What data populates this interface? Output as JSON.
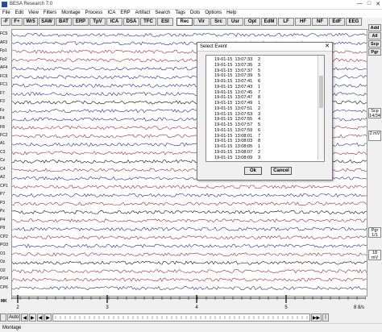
{
  "window": {
    "title": "BESA Research 7.0",
    "controls": [
      "—",
      "□",
      "✕"
    ]
  },
  "menu": [
    "File",
    "Edit",
    "View",
    "Filters",
    "Montage",
    "Process",
    "ICA",
    "ERP",
    "Artifact",
    "Search",
    "Tags",
    "Dots",
    "Options",
    "Help"
  ],
  "toolbar": [
    {
      "label": "-F",
      "w": 12
    },
    {
      "label": "F+",
      "w": 14
    },
    {
      "label": "Wr5",
      "w": 18
    },
    {
      "label": "SAW",
      "w": 20
    },
    {
      "label": "BAT",
      "w": 20
    },
    {
      "label": "ERP",
      "w": 20
    },
    {
      "label": "TpV",
      "w": 20
    },
    {
      "label": "ICA",
      "w": 20
    },
    {
      "label": "DSA",
      "w": 20
    },
    {
      "label": "TFC",
      "w": 20
    },
    {
      "label": "ESI",
      "w": 20
    },
    {
      "label": "Rec",
      "w": 20,
      "active": true,
      "sep": true
    },
    {
      "label": "Vir",
      "w": 20
    },
    {
      "label": "Src",
      "w": 20
    },
    {
      "label": "Usr",
      "w": 20
    },
    {
      "label": "Opt",
      "w": 20
    },
    {
      "label": "EdM",
      "w": 20
    },
    {
      "label": "LF",
      "w": 20
    },
    {
      "label": "HF",
      "w": 20
    },
    {
      "label": "NF",
      "w": 20
    },
    {
      "label": "EdF",
      "w": 20
    },
    {
      "label": "EEG",
      "w": 20
    }
  ],
  "channels": [
    "FC5",
    "AF3",
    "Fp1",
    "Fp2",
    "AF4",
    "FC6",
    "FC1",
    "F7",
    "F3",
    "Fz",
    "F4",
    "F8",
    "FC2",
    "A1",
    "C3",
    "Cz",
    "C4",
    "A2",
    "CP1",
    "P7",
    "P3",
    "Pz",
    "P4",
    "P8",
    "CP2",
    "PO3",
    "O1",
    "Oz",
    "O2",
    "PO4",
    "CP6"
  ],
  "right_panel": {
    "buttons": [
      "Add",
      "All",
      "Scp",
      "Pgr"
    ],
    "scp_label": "Scp 14/34",
    "scale_top": "2 mV",
    "pgr_label": "Pgr 1/1",
    "scale_bottom": "18 mV"
  },
  "marker_label": "MK",
  "time_ticks": [
    "2",
    "3",
    "4",
    "5"
  ],
  "time_end": "8 8/s",
  "bottom_bar": {
    "auto_label": "Auto",
    "nav": [
      "◀",
      "▶",
      "◀",
      "▶",
      "▶▶",
      "|"
    ]
  },
  "status_text": "Montage",
  "dialog": {
    "title": "Select Event",
    "close": "✕",
    "events": [
      {
        "time": "19-01-15  13:07:33",
        "n": "2"
      },
      {
        "time": "19-01-15  13:07:35",
        "n": "3"
      },
      {
        "time": "19-01-15  13:07:37",
        "n": "5"
      },
      {
        "time": "19-01-15  13:07:39",
        "n": "5"
      },
      {
        "time": "19-01-15  13:07:41",
        "n": "6"
      },
      {
        "time": "19-01-15  13:07:43",
        "n": "1"
      },
      {
        "time": "19-01-15  13:07:45",
        "n": "7"
      },
      {
        "time": "19-01-15  13:07:47",
        "n": "8"
      },
      {
        "time": "19-01-15  13:07:49",
        "n": "1"
      },
      {
        "time": "19-01-15  13:07:51",
        "n": "2"
      },
      {
        "time": "19-01-15  13:07:53",
        "n": "3"
      },
      {
        "time": "19-01-15  13:07:55",
        "n": "4"
      },
      {
        "time": "19-01-15  13:07:57",
        "n": "5"
      },
      {
        "time": "19-01-15  13:07:59",
        "n": "6"
      },
      {
        "time": "19-01-15  13:08:01",
        "n": "7"
      },
      {
        "time": "19-01-15  13:08:03",
        "n": "8"
      },
      {
        "time": "19-01-15  13:08:05",
        "n": "1"
      },
      {
        "time": "19-01-15  13:08:07",
        "n": "2"
      },
      {
        "time": "19-01-15  13:08:09",
        "n": "3"
      }
    ],
    "ok_label": "Ok",
    "cancel_label": "Cancel"
  },
  "colors": {
    "blue_trace": "#2a2aa8",
    "red_trace": "#a82a3a",
    "black_trace": "#111111"
  }
}
